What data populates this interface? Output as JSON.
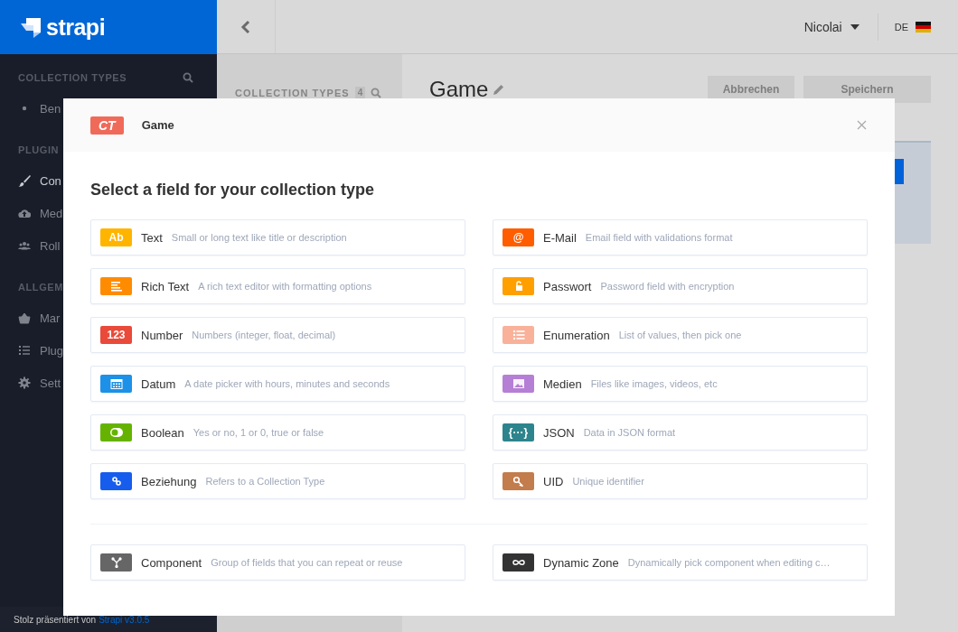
{
  "sidebar": {
    "logo": "strapi",
    "sections": [
      {
        "title": "COLLECTION TYPES",
        "search": true,
        "items": [
          {
            "label": "Ben",
            "kind": "bullet",
            "selected": false
          }
        ]
      },
      {
        "title": "PLUGIN",
        "items": [
          {
            "label": "Con",
            "kind": "brush",
            "selected": true
          },
          {
            "label": "Med",
            "kind": "cloud",
            "selected": false
          },
          {
            "label": "Roll",
            "kind": "users",
            "selected": false
          }
        ]
      },
      {
        "title": "ALLGEM",
        "items": [
          {
            "label": "Mar",
            "kind": "basket",
            "selected": false
          },
          {
            "label": "Plug",
            "kind": "list",
            "selected": false
          },
          {
            "label": "Sett",
            "kind": "gear",
            "selected": false
          }
        ]
      }
    ],
    "footer": {
      "text": "Stolz präsentiert von",
      "link": "Strapi v3.0.5"
    }
  },
  "header": {
    "user": "Nicolai",
    "language": "DE"
  },
  "content_types": {
    "title": "COLLECTION TYPES",
    "count": "4"
  },
  "editor": {
    "title": "Game",
    "buttons": [
      "Abbrechen",
      "Speichern"
    ]
  },
  "modal": {
    "badge": "CT",
    "name": "Game",
    "heading": "Select a field for your collection type",
    "fields": [
      {
        "kind": "text",
        "badge": "Ab",
        "label": "Text",
        "description": "Small or long text like title or description",
        "color": "#ffb500"
      },
      {
        "kind": "richtext",
        "label": "Rich Text",
        "description": "A rich text editor with formatting options",
        "color": "#ff8c00"
      },
      {
        "kind": "number",
        "badge": "123",
        "label": "Number",
        "description": "Numbers (integer, float, decimal)",
        "color": "#e94a3a"
      },
      {
        "kind": "date",
        "label": "Datum",
        "description": "A date picker with hours, minutes and seconds",
        "color": "#1c91e7"
      },
      {
        "kind": "boolean",
        "label": "Boolean",
        "description": "Yes or no, 1 or 0, true or false",
        "color": "#65b300"
      },
      {
        "kind": "relation",
        "label": "Beziehung",
        "description": "Refers to a Collection Type",
        "color": "#175ded"
      },
      {
        "kind": "email",
        "badge": "@",
        "label": "E-Mail",
        "description": "Email field with validations format",
        "color": "#ff5d00"
      },
      {
        "kind": "password",
        "label": "Passwort",
        "description": "Password field with encryption",
        "color": "#ff9f00"
      },
      {
        "kind": "enumeration",
        "label": "Enumeration",
        "description": "List of values, then pick one",
        "color": "#f9b199"
      },
      {
        "kind": "media",
        "label": "Medien",
        "description": "Files like images, videos, etc",
        "color": "#b57fd6"
      },
      {
        "kind": "json",
        "badge": "{···}",
        "label": "JSON",
        "description": "Data in JSON format",
        "color": "#2d848c"
      },
      {
        "kind": "uid",
        "label": "UID",
        "description": "Unique identifier",
        "color": "#c37c4c"
      }
    ],
    "extra_fields": [
      {
        "kind": "component",
        "label": "Component",
        "description": "Group of fields that you can repeat or reuse",
        "color": "#666666"
      },
      {
        "kind": "dynamiczone",
        "label": "Dynamic Zone",
        "description": "Dynamically pick component when editing c…",
        "color": "#333333"
      }
    ]
  }
}
